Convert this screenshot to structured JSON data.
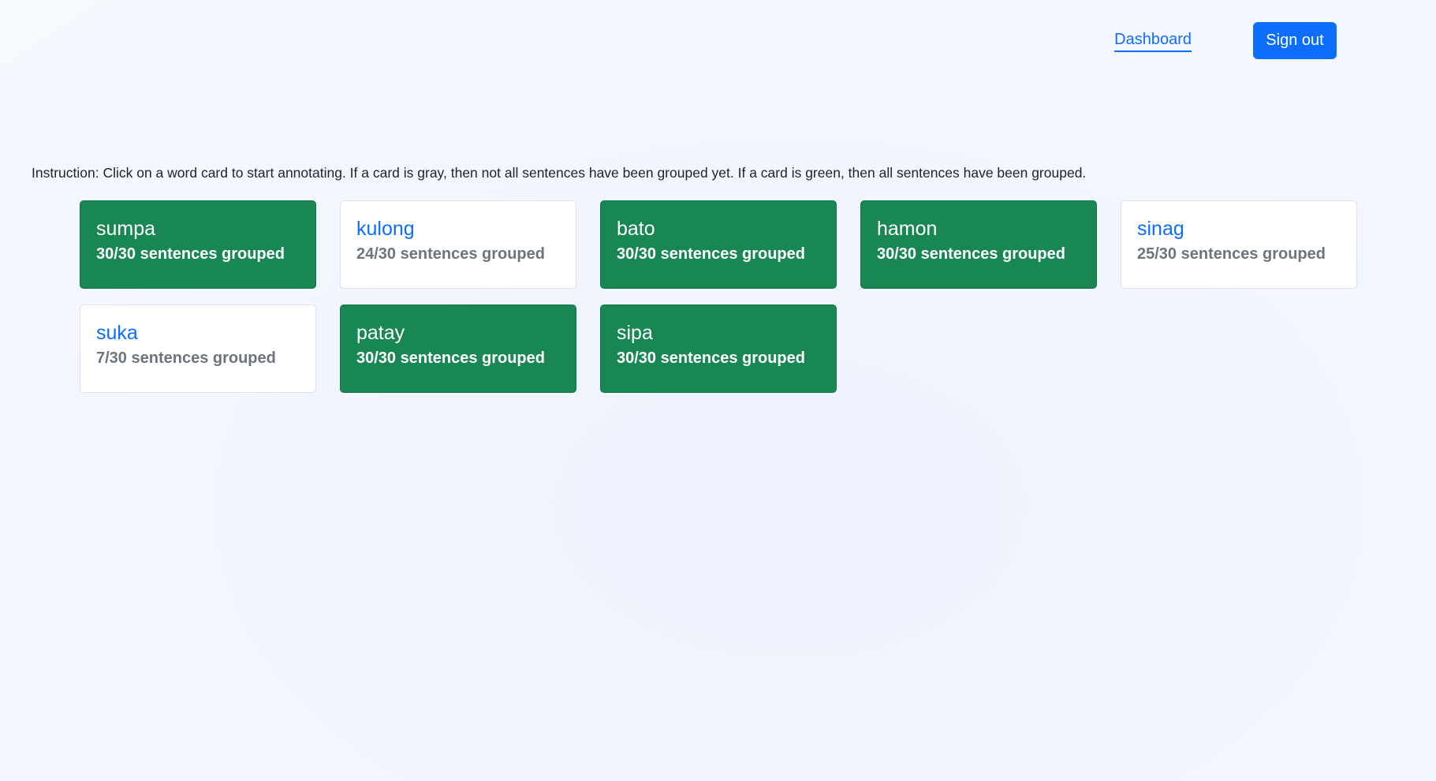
{
  "nav": {
    "dashboard_label": "Dashboard",
    "signout_label": "Sign out"
  },
  "instruction": "Instruction: Click on a word card to start annotating. If a card is gray, then not all sentences have been grouped yet. If a card is green, then all sentences have been grouped.",
  "colors": {
    "complete": "#198754",
    "incomplete": "#ffffff",
    "accent": "#0d6efd"
  },
  "cards": [
    {
      "word": "sumpa",
      "progress": "30/30 sentences grouped",
      "status": "complete"
    },
    {
      "word": "kulong",
      "progress": "24/30 sentences grouped",
      "status": "incomplete"
    },
    {
      "word": "bato",
      "progress": "30/30 sentences grouped",
      "status": "complete"
    },
    {
      "word": "hamon",
      "progress": "30/30 sentences grouped",
      "status": "complete"
    },
    {
      "word": "sinag",
      "progress": "25/30 sentences grouped",
      "status": "incomplete"
    },
    {
      "word": "suka",
      "progress": "7/30 sentences grouped",
      "status": "incomplete"
    },
    {
      "word": "patay",
      "progress": "30/30 sentences grouped",
      "status": "complete"
    },
    {
      "word": "sipa",
      "progress": "30/30 sentences grouped",
      "status": "complete"
    }
  ]
}
